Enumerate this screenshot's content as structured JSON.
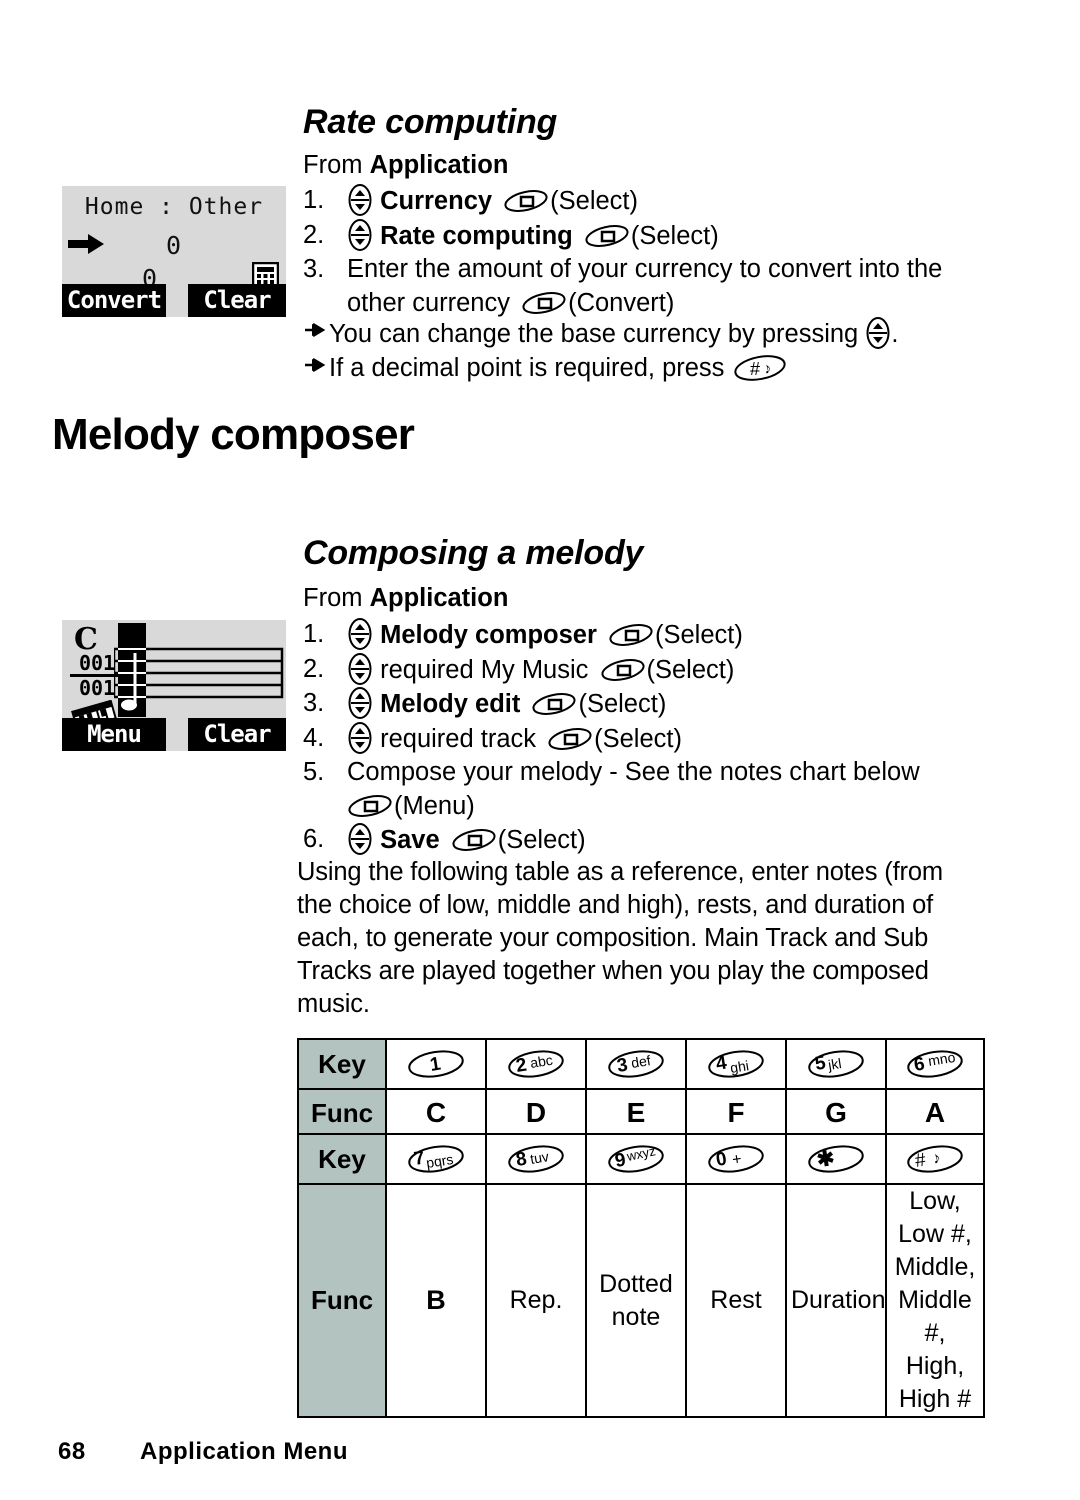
{
  "page": {
    "number": "68",
    "footer_title": "Application Menu"
  },
  "section_rate": {
    "heading": "Rate computing",
    "from_label_prefix": "From ",
    "from_label_bold": "Application",
    "steps": [
      {
        "num": "1.",
        "bold_text": "Currency",
        "tail": "(Select)"
      },
      {
        "num": "2.",
        "bold_text": "Rate computing",
        "tail": "(Select)"
      },
      {
        "num": "3.",
        "line1": "Enter the amount of your currency to convert into the",
        "line2_pre": "other currency ",
        "line2_tail": "(Convert)"
      }
    ],
    "notes": [
      {
        "text_before": "You can change the base currency by pressing ",
        "text_after": "."
      },
      {
        "text_before": "If a decimal point is required, press ",
        "text_after": ""
      }
    ]
  },
  "screen_currency": {
    "title": "Home : Other",
    "value_top": "0",
    "value_bottom": "0",
    "calculator_icon": "calculator-icon",
    "cursor_icon": "right-arrow-icon",
    "softkey_left": "Convert",
    "softkey_right": "Clear"
  },
  "chapter": {
    "title": "Melody composer"
  },
  "section_melody": {
    "heading": "Composing a melody",
    "from_label_prefix": "From ",
    "from_label_bold": "Application",
    "steps": [
      {
        "num": "1.",
        "bold_text": "Melody composer",
        "tail": "(Select)"
      },
      {
        "num": "2.",
        "plain_text": "required My Music",
        "tail": "(Select)"
      },
      {
        "num": "3.",
        "bold_text": "Melody edit",
        "tail": "(Select)"
      },
      {
        "num": "4.",
        "plain_text": "required track",
        "tail": "(Select)"
      },
      {
        "num": "5.",
        "line1": "Compose your melody - See the notes chart below",
        "line2_tail": "(Menu)"
      },
      {
        "num": "6.",
        "bold_text": "Save",
        "tail": "(Select)"
      }
    ],
    "paragraph": "Using the following table as a reference, enter notes (from the choice of low, middle and high), rests, and duration of each, to generate your composition. Main Track and Sub Tracks are played together when you play the composed music."
  },
  "screen_melody": {
    "clef": "C",
    "bar_current": "001",
    "bar_total": "001",
    "instrument_icon": "piano-keyboard-icon",
    "softkey_left": "Menu",
    "softkey_right": "Clear"
  },
  "notes_table_1": {
    "row_labels": {
      "key": "Key",
      "func": "Func"
    },
    "keys": [
      {
        "digit": "1",
        "letters": ""
      },
      {
        "digit": "2",
        "letters": "abc"
      },
      {
        "digit": "3",
        "letters": "def"
      },
      {
        "digit": "4",
        "letters": "ghi"
      },
      {
        "digit": "5",
        "letters": "jkl"
      },
      {
        "digit": "6",
        "letters": "mno"
      }
    ],
    "funcs": [
      "C",
      "D",
      "E",
      "F",
      "G",
      "A"
    ]
  },
  "notes_table_2": {
    "row_labels": {
      "key": "Key",
      "func": "Func"
    },
    "keys": [
      {
        "digit": "7",
        "letters": "pqrs"
      },
      {
        "digit": "8",
        "letters": "tuv"
      },
      {
        "digit": "9",
        "letters": "wxyz"
      },
      {
        "digit": "0",
        "letters": "+"
      },
      {
        "digit": "✳",
        "letters": ""
      },
      {
        "digit": "#",
        "letters": ""
      }
    ],
    "funcs": [
      "B",
      "Rep.",
      "Dotted note",
      "Rest",
      "Duration",
      "Low,\nLow #,\nMiddle,\nMiddle #,\nHigh,\nHigh #"
    ],
    "func_last_lines": [
      "Low,",
      "Low #,",
      "Middle,",
      "Middle #,",
      "High,",
      "High #"
    ]
  },
  "colors": {
    "table_header_fill": "#b3c3bf",
    "lcd_background": "#d9d9d9",
    "softkey_background": "#000000",
    "text": "#000000"
  },
  "icons": {
    "nav_key": "navigation-up-down-key-icon",
    "soft_key": "soft-key-icon",
    "hash_key": "hash-key-icon",
    "bullet_arrow": "arrow-bullet-icon"
  }
}
